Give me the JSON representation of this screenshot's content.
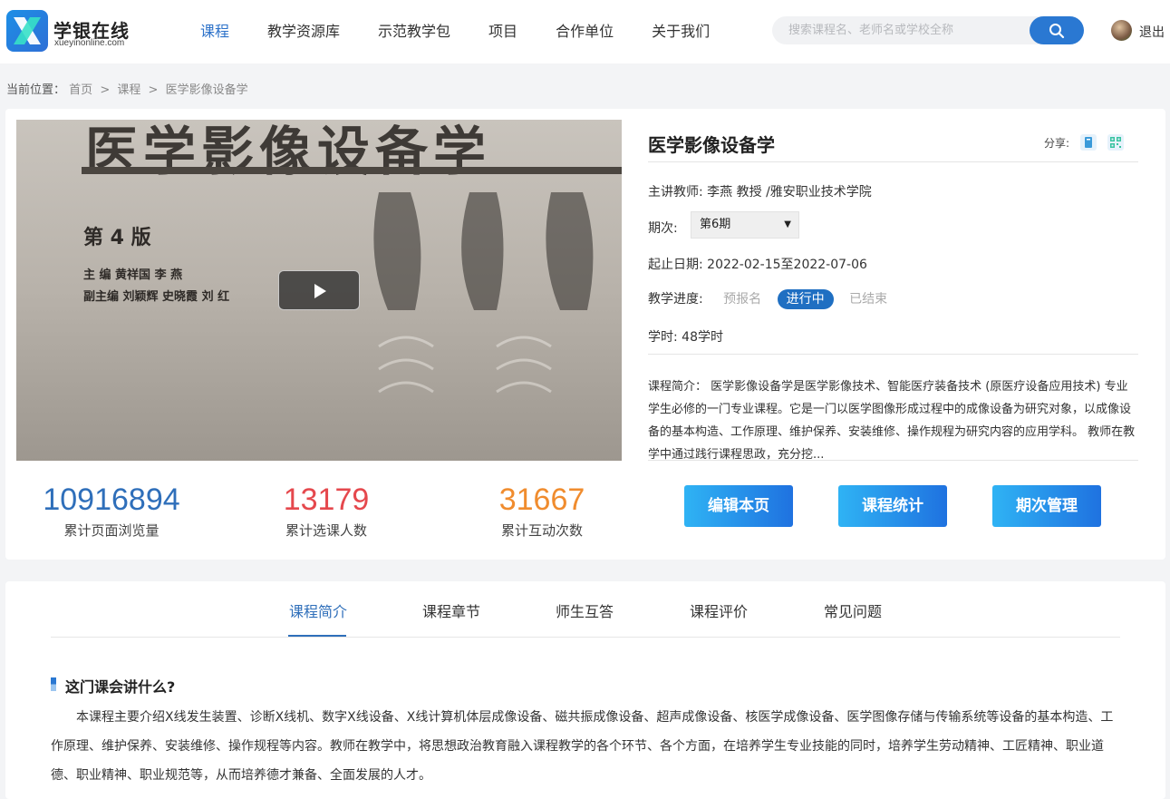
{
  "header": {
    "logo_title": "学银在线",
    "logo_sub": "xueyinonline.com",
    "nav": [
      "课程",
      "教学资源库",
      "示范教学包",
      "项目",
      "合作单位",
      "关于我们"
    ],
    "search_placeholder": "搜索课程名、老师名或学校全称",
    "logout": "退出"
  },
  "breadcrumb": {
    "prefix": "当前位置：",
    "items": [
      "首页",
      "课程",
      "医学影像设备学"
    ],
    "sep": ">"
  },
  "cover": {
    "book_title": "医学影像设备学",
    "edition": "第 4 版",
    "editors_line1": "主  编  黄祥国  李  燕",
    "editors_line2": "副主编  刘颖辉  史晓霞  刘  红"
  },
  "stats": [
    {
      "value": "10916894",
      "label": "累计页面浏览量"
    },
    {
      "value": "13179",
      "label": "累计选课人数"
    },
    {
      "value": "31667",
      "label": "累计互动次数"
    }
  ],
  "course": {
    "title": "医学影像设备学",
    "share_label": "分享:",
    "teacher_label": "主讲教师:",
    "teacher": "李燕 教授 /雅安职业技术学院",
    "term_label": "期次:",
    "term_value": "第6期",
    "dates_label": "起止日期:",
    "dates": "2022-02-15至2022-07-06",
    "progress_label": "教学进度:",
    "progress_states": [
      "预报名",
      "进行中",
      "已结束"
    ],
    "hours_label": "学时:",
    "hours": "48学时",
    "intro_label": "课程简介：",
    "intro": "医学影像设备学是医学影像技术、智能医疗装备技术 (原医疗设备应用技术) 专业学生必修的一门专业课程。它是一门以医学图像形成过程中的成像设备为研究对象，以成像设备的基本构造、工作原理、维护保养、安装维修、操作规程为研究内容的应用学科。 教师在教学中通过践行课程思政，充分挖..."
  },
  "actions": [
    "编辑本页",
    "课程统计",
    "期次管理"
  ],
  "tabs": [
    "课程简介",
    "课程章节",
    "师生互答",
    "课程评价",
    "常见问题"
  ],
  "section": {
    "title": "这门课会讲什么?",
    "body": "本课程主要介绍X线发生装置、诊断X线机、数字X线设备、X线计算机体层成像设备、磁共振成像设备、超声成像设备、核医学成像设备、医学图像存储与传输系统等设备的基本构造、工作原理、维护保养、安装维修、操作规程等内容。教师在教学中，将思想政治教育融入课程教学的各个环节、各个方面，在培养学生专业技能的同时，培养学生劳动精神、工匠精神、职业道德、职业精神、职业规范等，从而培养德才兼备、全面发展的人才。"
  }
}
